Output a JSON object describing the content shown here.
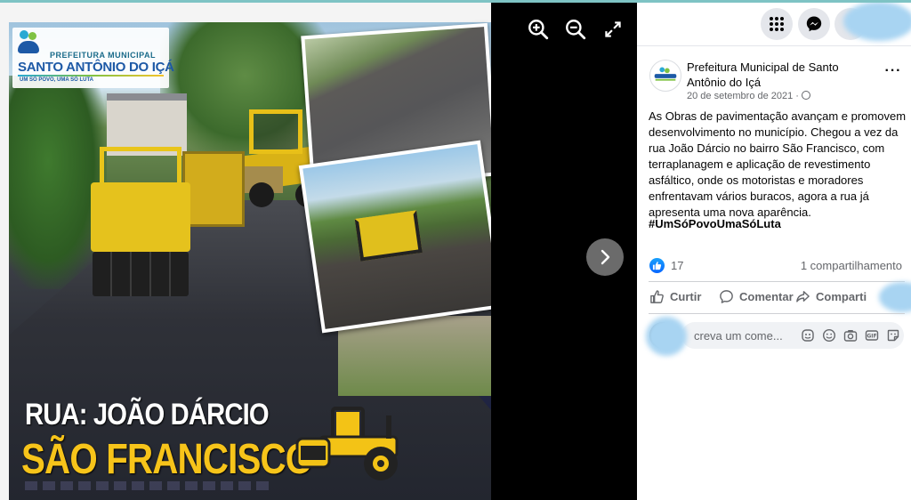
{
  "colors": {
    "accent_blue": "#0866ff",
    "title_yellow": "#f7c41a",
    "viewer_bg": "#000000",
    "panel_bg": "#ffffff",
    "secondary_text": "#65676b"
  },
  "viewer": {
    "image": {
      "logo_prefix": "PREFEITURA MUNICIPAL",
      "logo_name": "SANTO ANTÔNIO DO IÇÁ",
      "logo_slogan": "UM SÓ POVO, UMA SÓ LUTA",
      "title_line1": "RUA: JOÃO DÁRCIO",
      "title_line2": "SÃO FRANCISCO"
    },
    "controls": {
      "zoom_in_icon": "zoom-in-icon",
      "zoom_out_icon": "zoom-out-icon",
      "fullscreen_icon": "fullscreen-icon",
      "next_icon": "chevron-right-icon"
    }
  },
  "topbar": {
    "menu_icon": "grid-menu-icon",
    "messenger_icon": "messenger-icon"
  },
  "post": {
    "page_name": "Prefeitura Municipal de Santo Antônio do Içá",
    "date": "20 de setembro de 2021 ·",
    "privacy_icon": "globe-icon",
    "more_label": "···",
    "text": "As Obras de pavimentação avançam e promovem desenvolvimento no município. Chegou a vez da rua João Dárcio no bairro São Francisco, com terraplanagem e aplicação de revestimento asfáltico, onde os motoristas e moradores enfrentavam vários buracos, agora a rua já apresenta uma nova aparência.",
    "hashtag": "#UmSóPovoUmaSóLuta",
    "reactions": {
      "like_count": "17",
      "shares": "1 compartilhamento"
    },
    "actions": {
      "like": "Curtir",
      "comment": "Comentar",
      "share": "Comparti"
    },
    "comment_box": {
      "placeholder": "creva um come..."
    }
  }
}
